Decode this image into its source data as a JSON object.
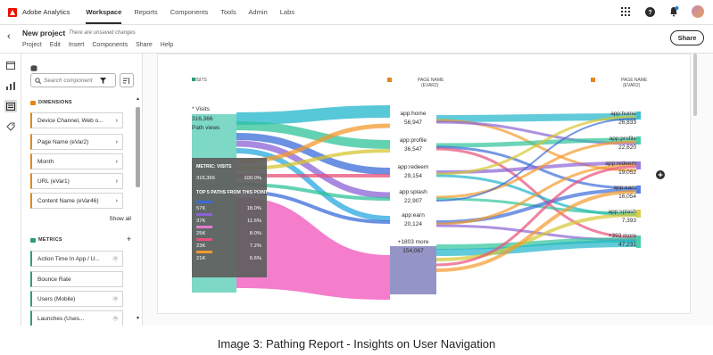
{
  "topbar": {
    "app_name": "Adobe Analytics",
    "nav": [
      "Workspace",
      "Reports",
      "Components",
      "Tools",
      "Admin",
      "Labs"
    ]
  },
  "project": {
    "title": "New project",
    "unsaved_note": "There are unsaved changes",
    "menu": [
      "Project",
      "Edit",
      "Insert",
      "Components",
      "Share",
      "Help"
    ],
    "share_label": "Share"
  },
  "panel": {
    "search_placeholder": "Search component",
    "dimensions_header": "DIMENSIONS",
    "dimensions": [
      "Device Channel, Web o...",
      "Page Name (eVar2)",
      "Month",
      "URL (eVar1)",
      "Content Name (eVar46)"
    ],
    "show_all": "Show all",
    "metrics_header": "METRICS",
    "metrics": [
      "Action Time In App / U...",
      "Bounce Rate",
      "Users (Mobile)",
      "Launches (Uses..."
    ]
  },
  "flow": {
    "col1_header": "VISITS",
    "col2_header": "PAGE NAME\n(EVAR2)",
    "col3_header": "PAGE NAME\n(EVAR2)",
    "root": {
      "label": "* Visits",
      "value": "316,366",
      "sub": "Path views"
    },
    "mid_nodes": [
      {
        "label": "app:home",
        "value": "56,947"
      },
      {
        "label": "app:profile",
        "value": "36,547"
      },
      {
        "label": "app:redeem",
        "value": "29,154"
      },
      {
        "label": "app:splash",
        "value": "22,907"
      },
      {
        "label": "app:earn",
        "value": "20,124"
      },
      {
        "label": "+1803 more",
        "value": "154,067"
      }
    ],
    "right_nodes": [
      {
        "label": "app:home",
        "value": "26,833"
      },
      {
        "label": "app:profile",
        "value": "22,620"
      },
      {
        "label": "app:redeem",
        "value": "19,052"
      },
      {
        "label": "app:earn",
        "value": "16,054"
      },
      {
        "label": "app:splash",
        "value": "7,393"
      },
      {
        "label": "+393 more",
        "value": "47,231"
      }
    ],
    "tooltip": {
      "metric_title": "METRIC: VISITS",
      "metric_value": "316,366",
      "metric_pct": "100.0%",
      "paths_title": "TOP 5 PATHS FROM THIS POINT",
      "paths": [
        {
          "value": "57K",
          "pct": "18.0%",
          "color": "#3b6bd8"
        },
        {
          "value": "37K",
          "pct": "11.6%",
          "color": "#8b63d6"
        },
        {
          "value": "25K",
          "pct": "8.0%",
          "color": "#e07cd0"
        },
        {
          "value": "23K",
          "pct": "7.2%",
          "color": "#e8507a"
        },
        {
          "value": "21K",
          "pct": "6.6%",
          "color": "#f39a2c"
        }
      ]
    }
  },
  "caption": "Image 3: Pathing Report - Insights on User Navigation"
}
